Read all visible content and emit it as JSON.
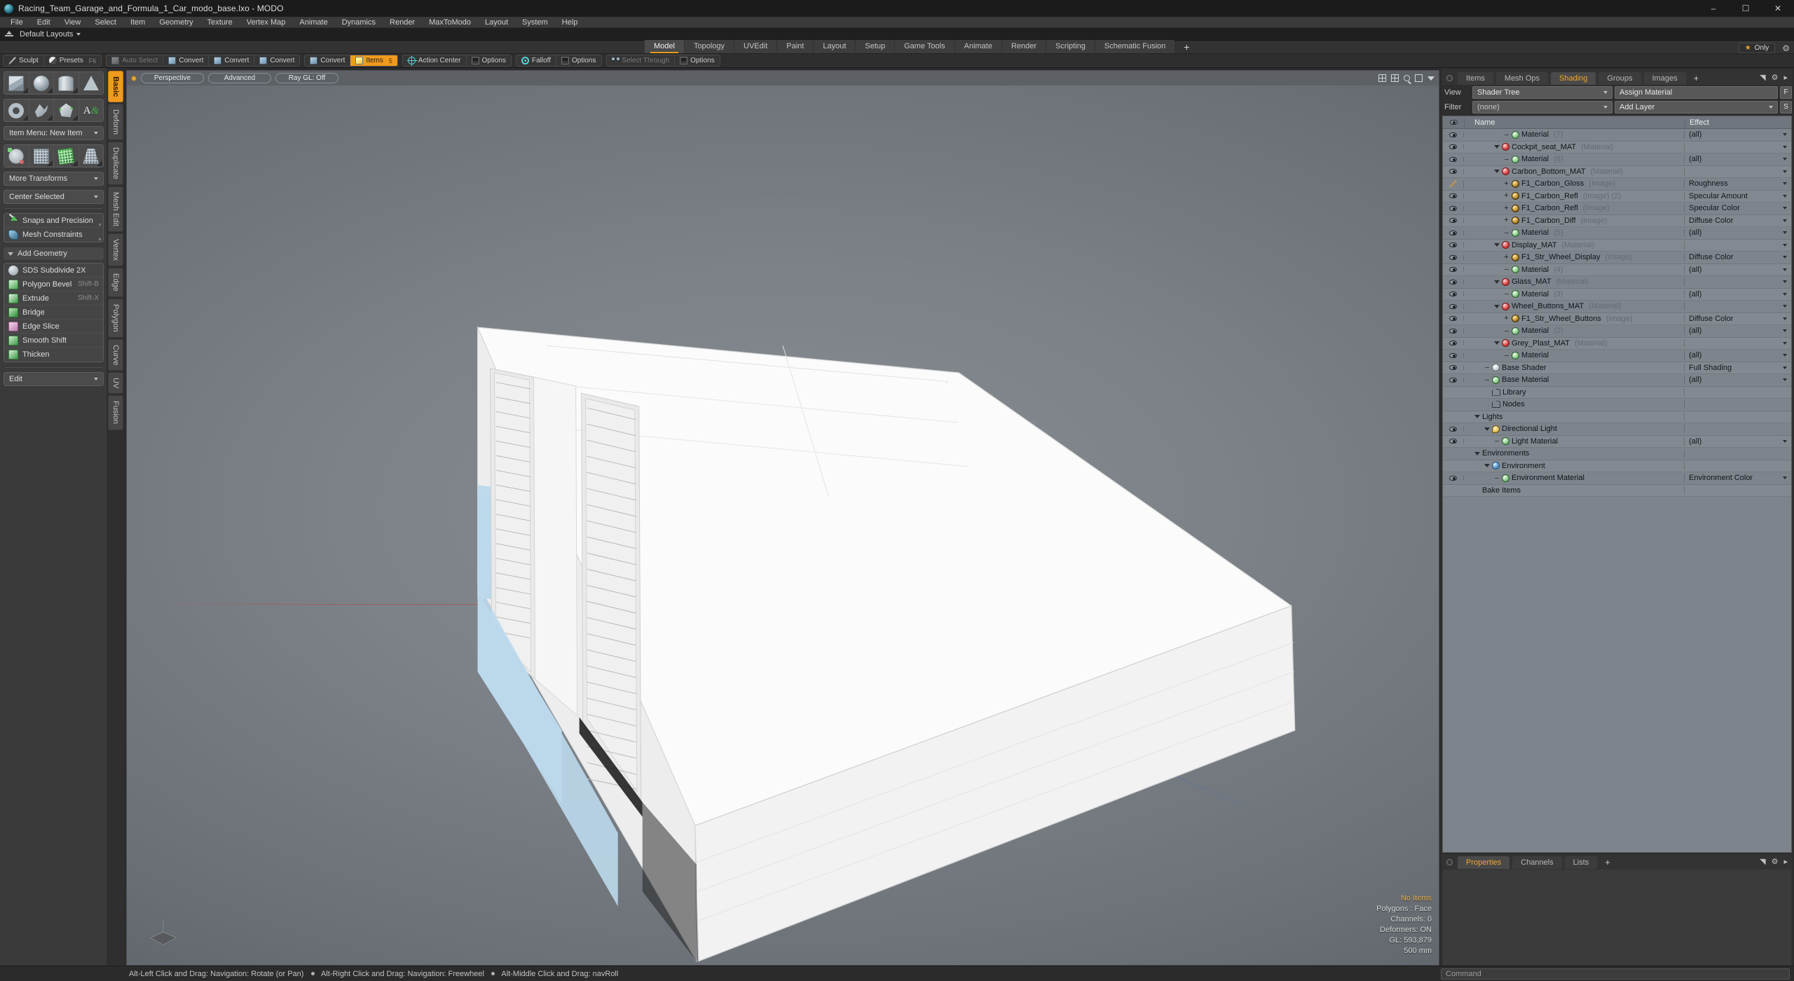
{
  "window": {
    "title": "Racing_Team_Garage_and_Formula_1_Car_modo_base.lxo - MODO",
    "minimize": "–",
    "maximize": "☐",
    "close": "✕"
  },
  "menubar": {
    "items": [
      "File",
      "Edit",
      "View",
      "Select",
      "Item",
      "Geometry",
      "Texture",
      "Vertex Map",
      "Animate",
      "Dynamics",
      "Render",
      "MaxToModo",
      "Layout",
      "System",
      "Help"
    ]
  },
  "layoutbar": {
    "label": "Default Layouts"
  },
  "modestrip": {
    "tabs": [
      "Model",
      "Topology",
      "UVEdit",
      "Paint",
      "Layout",
      "Setup",
      "Game Tools",
      "Animate",
      "Render",
      "Scripting",
      "Schematic Fusion"
    ],
    "active": "Model",
    "plus": "+",
    "only_badge": "Only"
  },
  "toolbar": {
    "groups": [
      {
        "buttons": [
          {
            "label": "Sculpt",
            "icon": "pen-icon",
            "state": "normal",
            "key": ""
          },
          {
            "label": "Presets",
            "icon": "presets-icon",
            "state": "normal",
            "key": "F6"
          }
        ]
      },
      {
        "buttons": [
          {
            "label": "Auto Select",
            "icon": "cube-gray-icon",
            "state": "dim",
            "key": ""
          },
          {
            "label": "Convert",
            "icon": "convert-vertex-icon",
            "state": "normal",
            "key": ""
          },
          {
            "label": "Convert",
            "icon": "convert-edge-icon",
            "state": "normal",
            "key": ""
          },
          {
            "label": "Convert",
            "icon": "convert-polygon-icon",
            "state": "normal",
            "key": ""
          }
        ]
      },
      {
        "buttons": [
          {
            "label": "Convert",
            "icon": "convert-item-icon",
            "state": "normal",
            "key": ""
          },
          {
            "label": "Items",
            "icon": "items-cube-icon",
            "state": "active",
            "key": "5"
          }
        ]
      },
      {
        "buttons": [
          {
            "label": "Action Center",
            "icon": "action-center-icon",
            "state": "normal",
            "key": ""
          },
          {
            "label": "Options",
            "icon": "options-icon",
            "state": "normal",
            "key": ""
          }
        ]
      },
      {
        "buttons": [
          {
            "label": "Falloff",
            "icon": "falloff-icon",
            "state": "normal",
            "key": ""
          },
          {
            "label": "Options",
            "icon": "options-icon",
            "state": "normal",
            "key": ""
          }
        ]
      },
      {
        "buttons": [
          {
            "label": "Select Through",
            "icon": "select-through-icon",
            "state": "dim",
            "key": ""
          },
          {
            "label": "Options",
            "icon": "options-icon",
            "state": "normal",
            "key": ""
          }
        ]
      }
    ]
  },
  "leftpanel": {
    "primitives_row1": [
      "cube-shape",
      "sphere-shape",
      "cylinder-shape",
      "cone-shape"
    ],
    "primitives_row2": [
      "torus-shape",
      "curve-shape",
      "polygon-shape",
      "text-shape"
    ],
    "item_menu": "Item Menu: New Item",
    "transform_row": [
      "axis-transform-shape",
      "mesh-transform-shape",
      "green-mesh-shape",
      "taper-shape"
    ],
    "more_transforms": "More Transforms",
    "center_selected": "Center Selected",
    "snaps": "Snaps and Precision",
    "constraints": "Mesh Constraints",
    "add_geometry": "Add Geometry",
    "geometry_tools": [
      {
        "label": "SDS Subdivide 2X",
        "hotkey": "",
        "icon": "sds-icon"
      },
      {
        "label": "Polygon Bevel",
        "hotkey": "Shift-B",
        "icon": "bevel-icon"
      },
      {
        "label": "Extrude",
        "hotkey": "Shift-X",
        "icon": "extrude-icon"
      },
      {
        "label": "Bridge",
        "hotkey": "",
        "icon": "bridge-icon"
      },
      {
        "label": "Edge Slice",
        "hotkey": "",
        "icon": "slice-icon"
      },
      {
        "label": "Smooth Shift",
        "hotkey": "",
        "icon": "smooth-icon"
      },
      {
        "label": "Thicken",
        "hotkey": "",
        "icon": "thicken-icon"
      }
    ],
    "edit_dropdown": "Edit",
    "vtabs": [
      "Basic",
      "Deform",
      "Duplicate",
      "Mesh Edit",
      "Vertex",
      "Edge",
      "Polygon",
      "Curve",
      "UV",
      "Fusion"
    ],
    "vtab_active": "Basic"
  },
  "viewport": {
    "pills": [
      "Perspective",
      "Advanced",
      "Ray GL: Off"
    ],
    "stats": {
      "items": "No Items",
      "polygons": "Polygons : Face",
      "channels": "Channels: 0",
      "deformers": "Deformers: ON",
      "gl": "GL: 593,879",
      "scale": "500 mm"
    }
  },
  "rightpanel": {
    "tabs": [
      "Items",
      "Mesh Ops",
      "Shading",
      "Groups",
      "Images"
    ],
    "tab_active": "Shading",
    "tab_plus": "+",
    "view_label": "View",
    "view_value": "Shader Tree",
    "assign_material": "Assign Material",
    "btn_f": "F",
    "filter_label": "Filter",
    "filter_value": "(none)",
    "add_layer": "Add Layer",
    "btn_s": "S",
    "columns": {
      "name": "Name",
      "effect": "Effect"
    },
    "rows": [
      {
        "eye": "eye",
        "indent": 4,
        "twisty": "stub",
        "icon": "sph green",
        "name": "Material",
        "sub": "(7)",
        "effect": "(all)",
        "dropdown": true
      },
      {
        "eye": "eye",
        "indent": 3,
        "twisty": "down",
        "icon": "sph red",
        "name": "Cockpit_seat_MAT",
        "sub": "(Material)",
        "effect": "",
        "dropdown": true
      },
      {
        "eye": "eye",
        "indent": 4,
        "twisty": "stub",
        "icon": "sph green",
        "name": "Material",
        "sub": "(6)",
        "effect": "(all)",
        "dropdown": true
      },
      {
        "eye": "eye",
        "indent": 3,
        "twisty": "down",
        "icon": "sph red",
        "name": "Carbon_Bottom_MAT",
        "sub": "(Material)",
        "effect": "",
        "dropdown": true
      },
      {
        "eye": "brush",
        "indent": 4,
        "twisty": "plus",
        "icon": "sph img",
        "name": "F1_Carbon_Gloss",
        "sub": "(Image)",
        "effect": "Roughness",
        "dropdown": true
      },
      {
        "eye": "eye",
        "indent": 4,
        "twisty": "plus",
        "icon": "sph img",
        "name": "F1_Carbon_Refl",
        "sub": "(Image) (2)",
        "effect": "Specular Amount",
        "dropdown": true
      },
      {
        "eye": "eye",
        "indent": 4,
        "twisty": "plus",
        "icon": "sph img",
        "name": "F1_Carbon_Refl",
        "sub": "(Image)",
        "effect": "Specular Color",
        "dropdown": true
      },
      {
        "eye": "eye",
        "indent": 4,
        "twisty": "plus",
        "icon": "sph img",
        "name": "F1_Carbon_Diff",
        "sub": "(Image)",
        "effect": "Diffuse Color",
        "dropdown": true
      },
      {
        "eye": "eye",
        "indent": 4,
        "twisty": "stub",
        "icon": "sph green",
        "name": "Material",
        "sub": "(5)",
        "effect": "(all)",
        "dropdown": true
      },
      {
        "eye": "eye",
        "indent": 3,
        "twisty": "down",
        "icon": "sph red",
        "name": "Display_MAT",
        "sub": "(Material)",
        "effect": "",
        "dropdown": true
      },
      {
        "eye": "eye",
        "indent": 4,
        "twisty": "plus",
        "icon": "sph img",
        "name": "F1_Str_Wheel_Display",
        "sub": "(Image)",
        "effect": "Diffuse Color",
        "dropdown": true
      },
      {
        "eye": "eye",
        "indent": 4,
        "twisty": "stub",
        "icon": "sph green",
        "name": "Material",
        "sub": "(4)",
        "effect": "(all)",
        "dropdown": true
      },
      {
        "eye": "eye",
        "indent": 3,
        "twisty": "down",
        "icon": "sph red",
        "name": "Glass_MAT",
        "sub": "(Material)",
        "effect": "",
        "dropdown": true
      },
      {
        "eye": "eye",
        "indent": 4,
        "twisty": "stub",
        "icon": "sph green",
        "name": "Material",
        "sub": "(3)",
        "effect": "(all)",
        "dropdown": true
      },
      {
        "eye": "eye",
        "indent": 3,
        "twisty": "down",
        "icon": "sph red",
        "name": "Wheel_Buttons_MAT",
        "sub": "(Material)",
        "effect": "",
        "dropdown": true
      },
      {
        "eye": "eye",
        "indent": 4,
        "twisty": "plus",
        "icon": "sph img",
        "name": "F1_Str_Wheel_Buttons",
        "sub": "(Image)",
        "effect": "Diffuse Color",
        "dropdown": true
      },
      {
        "eye": "eye",
        "indent": 4,
        "twisty": "stub",
        "icon": "sph green",
        "name": "Material",
        "sub": "(2)",
        "effect": "(all)",
        "dropdown": true
      },
      {
        "eye": "eye",
        "indent": 3,
        "twisty": "down",
        "icon": "sph red",
        "name": "Grey_Plast_MAT",
        "sub": "(Material)",
        "effect": "",
        "dropdown": true
      },
      {
        "eye": "eye",
        "indent": 4,
        "twisty": "stub",
        "icon": "sph green",
        "name": "Material",
        "sub": "",
        "effect": "(all)",
        "dropdown": true
      },
      {
        "eye": "eye",
        "indent": 2,
        "twisty": "stub",
        "icon": "sph white",
        "name": "Base Shader",
        "sub": "",
        "effect": "Full Shading",
        "dropdown": true
      },
      {
        "eye": "eye",
        "indent": 2,
        "twisty": "stub",
        "icon": "sph green",
        "name": "Base Material",
        "sub": "",
        "effect": "(all)",
        "dropdown": true
      },
      {
        "eye": "none",
        "indent": 2,
        "twisty": "none",
        "icon": "folder",
        "name": "Library",
        "sub": "",
        "effect": "",
        "dropdown": false
      },
      {
        "eye": "none",
        "indent": 2,
        "twisty": "none",
        "icon": "folder",
        "name": "Nodes",
        "sub": "",
        "effect": "",
        "dropdown": false
      },
      {
        "eye": "none",
        "indent": 1,
        "twisty": "down",
        "icon": "none",
        "name": "Lights",
        "sub": "",
        "effect": "",
        "dropdown": false
      },
      {
        "eye": "eye",
        "indent": 2,
        "twisty": "down",
        "icon": "sph light",
        "name": "Directional Light",
        "sub": "",
        "effect": "",
        "dropdown": false
      },
      {
        "eye": "eye",
        "indent": 3,
        "twisty": "stub",
        "icon": "sph green",
        "name": "Light Material",
        "sub": "",
        "effect": "(all)",
        "dropdown": true
      },
      {
        "eye": "none",
        "indent": 1,
        "twisty": "down",
        "icon": "none",
        "name": "Environments",
        "sub": "",
        "effect": "",
        "dropdown": false
      },
      {
        "eye": "none",
        "indent": 2,
        "twisty": "down",
        "icon": "sph env",
        "name": "Environment",
        "sub": "",
        "effect": "",
        "dropdown": false
      },
      {
        "eye": "eye",
        "indent": 3,
        "twisty": "stub",
        "icon": "sph green",
        "name": "Environment Material",
        "sub": "",
        "effect": "Environment Color",
        "dropdown": true
      },
      {
        "eye": "none",
        "indent": 1,
        "twisty": "none",
        "icon": "none",
        "name": "Bake Items",
        "sub": "",
        "effect": "",
        "dropdown": false
      }
    ],
    "bottom_tabs": [
      "Properties",
      "Channels",
      "Lists"
    ],
    "bottom_tab_active": "Properties",
    "bottom_tab_plus": "+"
  },
  "statusbar": {
    "hints": [
      "Alt-Left Click and Drag: Navigation: Rotate (or Pan)",
      "Alt-Right Click and Drag: Navigation: Freewheel",
      "Alt-Middle Click and Drag: navRoll"
    ],
    "command_placeholder": "Command"
  },
  "colors": {
    "accent": "#f09a1e",
    "panel": "#3a3a3a",
    "tree_bg": "#7d848c",
    "viewport_bg": "#7b8187",
    "model_white": "#f7f7f7",
    "model_blue": "#b9d7ea"
  }
}
